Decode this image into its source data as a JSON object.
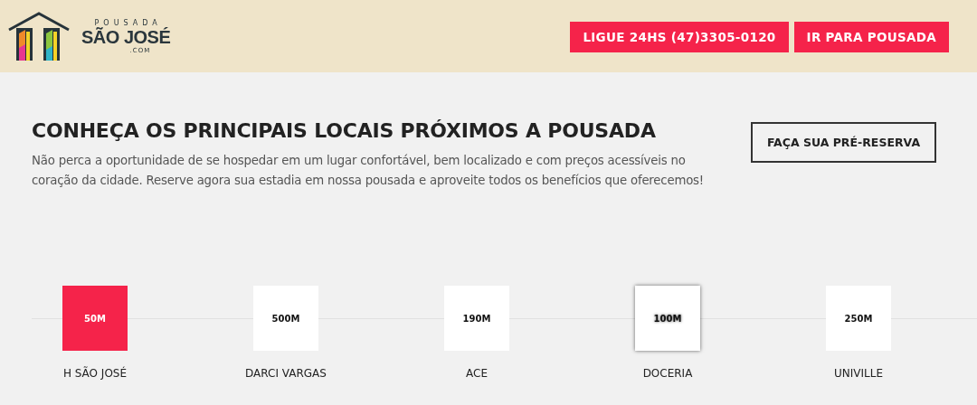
{
  "header": {
    "logo": {
      "top": "POUSADA",
      "main": "SÃO JOSÉ",
      "sub": ".COM"
    },
    "buttons": [
      "LIGUE 24HS (47)3305-0120",
      "IR PARA POUSADA"
    ]
  },
  "intro": {
    "title": "CONHEÇA OS PRINCIPAIS LOCAIS PRÓXIMOS A POUSADA",
    "text": "Não perca a oportunidade de se hospedar em um lugar confortável, bem localizado e com preços acessíveis no coração da cidade. Reserve agora sua estadia em nossa pousada e aproveite todos os benefícios que oferecemos!",
    "button": "FAÇA SUA PRÉ-RESERVA"
  },
  "places": [
    {
      "distance": "50M",
      "name": "H SÃO JOSÉ",
      "selected": true,
      "hovered": false
    },
    {
      "distance": "500M",
      "name": "DARCI VARGAS",
      "selected": false,
      "hovered": false
    },
    {
      "distance": "190M",
      "name": "ACE",
      "selected": false,
      "hovered": false
    },
    {
      "distance": "100M",
      "name": "DOCERIA",
      "selected": false,
      "hovered": true
    },
    {
      "distance": "250M",
      "name": "UNIVILLE",
      "selected": false,
      "hovered": false
    }
  ]
}
